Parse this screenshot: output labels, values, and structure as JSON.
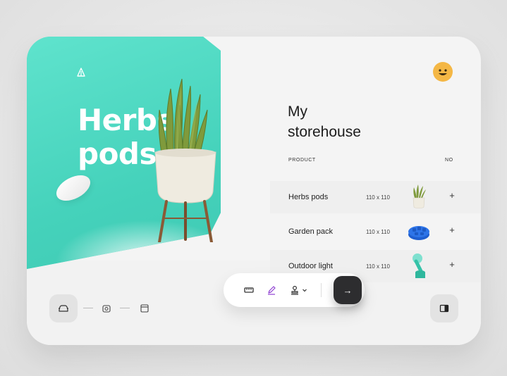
{
  "hero": {
    "title_line1": "Herbs",
    "title_line2": "pods",
    "logo_icon": "leaf-logo-icon",
    "accent_color": "#4fd9c3"
  },
  "header": {
    "avatar_icon": "smiley-face-icon",
    "avatar_color": "#f4b745"
  },
  "storehouse": {
    "title_line1": "My",
    "title_line2": "storehouse",
    "columns": [
      "PRODUCT",
      "NO"
    ],
    "rows": [
      {
        "name": "Herbs pods",
        "size": "110 x 110",
        "thumb_icon": "potted-plant-icon",
        "action": "+"
      },
      {
        "name": "Garden pack",
        "size": "110 x 110",
        "thumb_icon": "blue-gear-pack-icon",
        "action": "+"
      },
      {
        "name": "Outdoor light",
        "size": "110 x 110",
        "thumb_icon": "teal-lamp-icon",
        "action": "+"
      }
    ]
  },
  "toolbar": {
    "items": [
      "ruler-icon",
      "pen-icon",
      "stamp-icon"
    ],
    "dropdown_icon": "chevron-down-icon",
    "go_label": "→"
  },
  "steps": {
    "items": [
      "car-icon",
      "box-icon",
      "window-icon"
    ]
  },
  "panel_icon": "sidebar-panel-icon"
}
